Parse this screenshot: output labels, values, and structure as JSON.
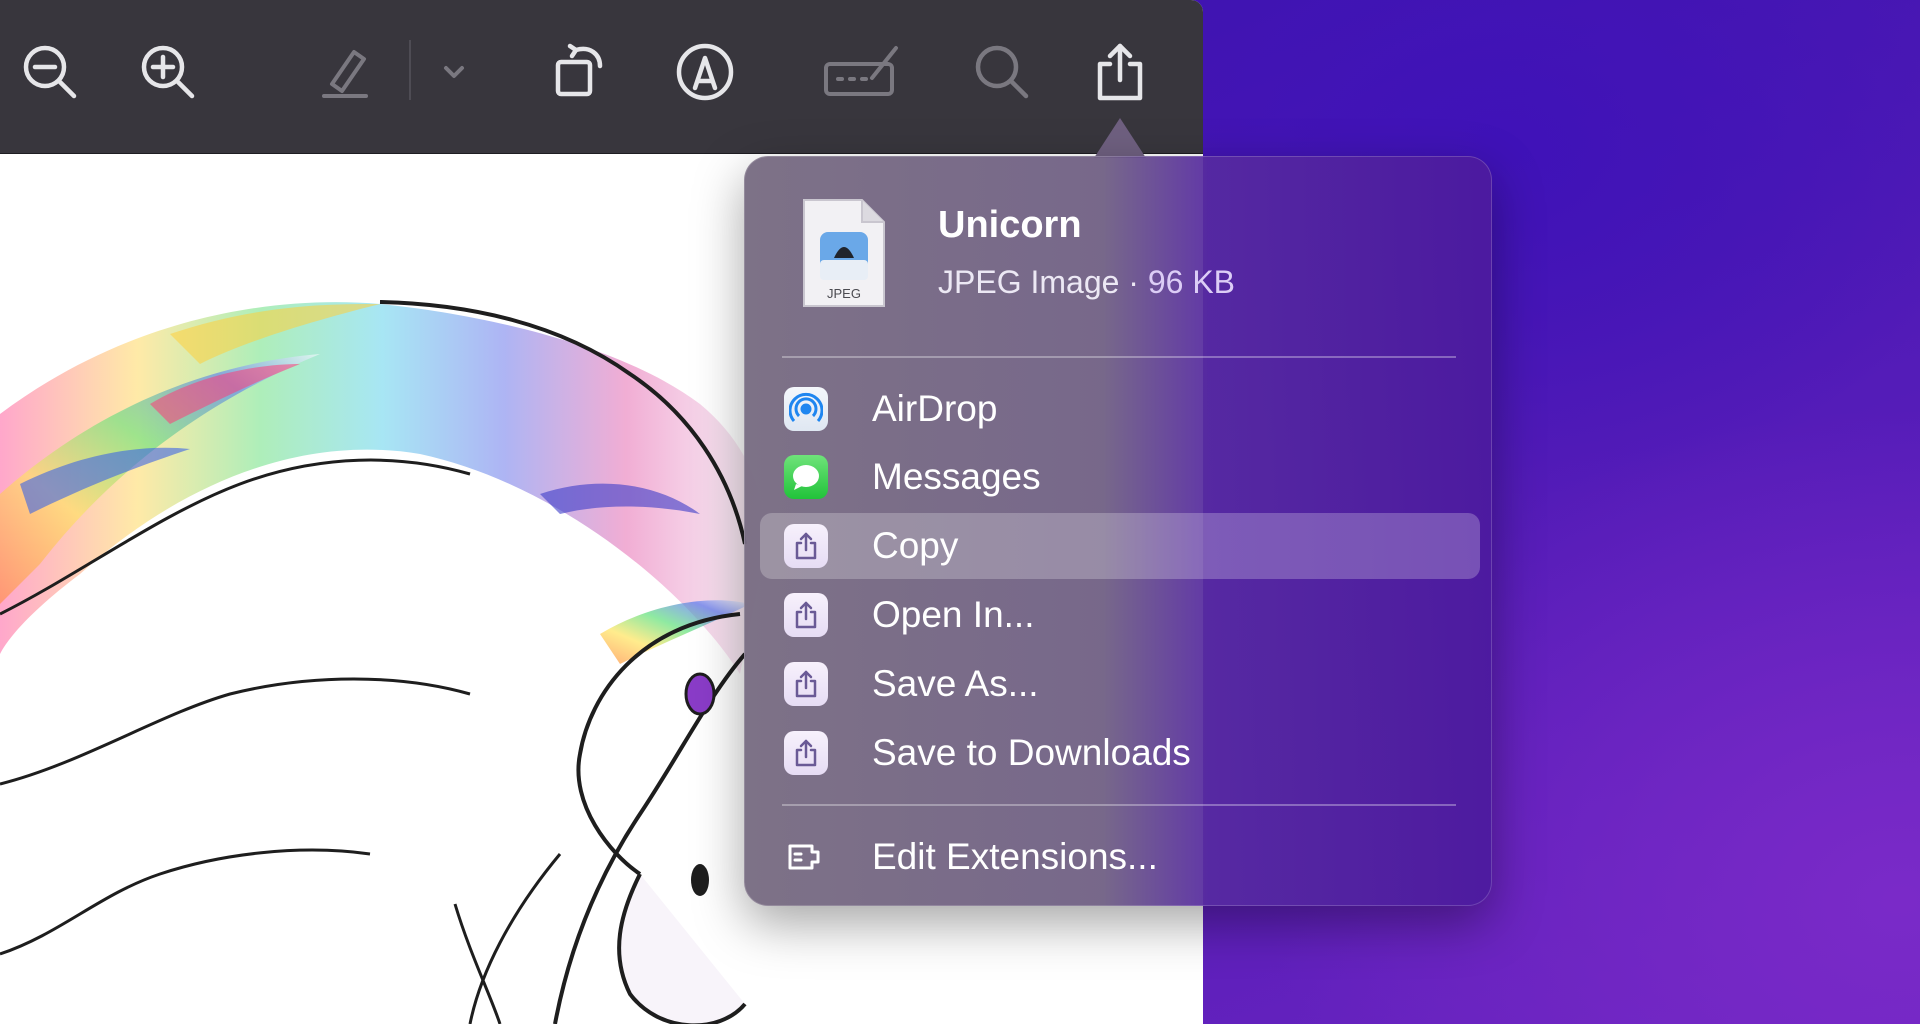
{
  "app": {
    "toolbar": {
      "buttons": [
        {
          "name": "zoom-out",
          "icon": "zoom-out-icon"
        },
        {
          "name": "zoom-in",
          "icon": "zoom-in-icon"
        },
        {
          "name": "highlight",
          "icon": "highlighter-icon"
        },
        {
          "name": "highlight-menu",
          "icon": "chevron-down-icon"
        },
        {
          "name": "rotate",
          "icon": "rotate-icon"
        },
        {
          "name": "markup",
          "icon": "markup-pen-icon"
        },
        {
          "name": "form-filling",
          "icon": "signature-icon"
        },
        {
          "name": "search",
          "icon": "search-icon"
        },
        {
          "name": "share",
          "icon": "share-icon"
        }
      ]
    }
  },
  "share_sheet": {
    "file": {
      "title": "Unicorn",
      "kind": "JPEG Image",
      "separator": " · ",
      "size": "96 KB",
      "icon_label": "JPEG"
    },
    "items": [
      {
        "label": "AirDrop",
        "icon": "airdrop-icon"
      },
      {
        "label": "Messages",
        "icon": "messages-icon"
      },
      {
        "label": "Copy",
        "icon": "share-icon",
        "selected": true
      },
      {
        "label": "Open In...",
        "icon": "share-icon"
      },
      {
        "label": "Save As...",
        "icon": "share-icon"
      },
      {
        "label": "Save to Downloads",
        "icon": "share-icon"
      }
    ],
    "footer": {
      "label": "Edit Extensions...",
      "icon": "extensions-icon"
    }
  },
  "colors": {
    "toolbar_bg": "#38363d",
    "icon_active": "#e6e6e9",
    "icon_disabled": "#7a7880",
    "size_accent": "#dccdf6",
    "messages_green": "#2bc940",
    "airdrop_blue": "#1f86f0"
  }
}
